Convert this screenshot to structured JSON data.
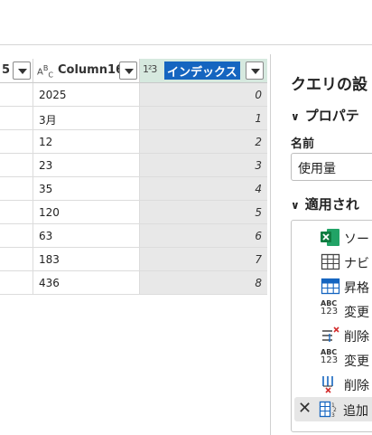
{
  "grid": {
    "columns": [
      {
        "label": "5",
        "type": ""
      },
      {
        "label": "Column16",
        "type": "abc"
      },
      {
        "label": "インデックス",
        "type": "123"
      }
    ],
    "type_abc": {
      "a": "A",
      "b": "B",
      "c": "C"
    },
    "type_123": "1²3",
    "rows": [
      {
        "col16": "2025",
        "index": "0"
      },
      {
        "col16": "3月",
        "index": "1"
      },
      {
        "col16": "12",
        "index": "2"
      },
      {
        "col16": "23",
        "index": "3"
      },
      {
        "col16": "35",
        "index": "4"
      },
      {
        "col16": "120",
        "index": "5"
      },
      {
        "col16": "63",
        "index": "6"
      },
      {
        "col16": "183",
        "index": "7"
      },
      {
        "col16": "436",
        "index": "8"
      }
    ]
  },
  "query_settings": {
    "title": "クエリの設",
    "properties_header": "プロパテ",
    "name_label": "名前",
    "name_value": "使用量",
    "applied_steps_header": "適用され",
    "steps": [
      {
        "label": "ソー",
        "icon": "excel-icon"
      },
      {
        "label": "ナビ",
        "icon": "table-grid-icon"
      },
      {
        "label": "昇格",
        "icon": "promote-headers-icon"
      },
      {
        "label": "変更",
        "icon": "change-type-icon"
      },
      {
        "label": "削除",
        "icon": "remove-rows-icon"
      },
      {
        "label": "変更",
        "icon": "change-type-icon"
      },
      {
        "label": "削除",
        "icon": "remove-columns-icon"
      },
      {
        "label": "追加",
        "icon": "add-index-icon",
        "active": true
      }
    ],
    "step_abc_top": "ABC",
    "step_abc_bottom": "123",
    "delete_glyph": "✕"
  },
  "colors": {
    "selected_header_bg": "#1565c0",
    "index_header_bg": "#d6e9df",
    "index_cell_bg": "#e8e8e8",
    "excel_green": "#1e7145"
  }
}
